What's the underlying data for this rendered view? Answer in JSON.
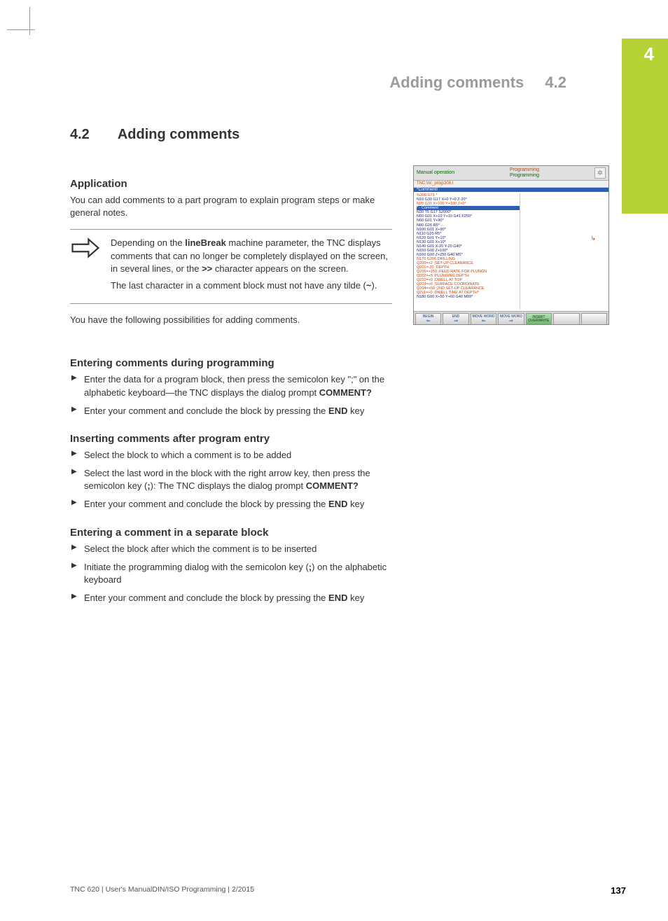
{
  "chapter_tab_number": "4",
  "header": {
    "title": "Adding comments",
    "number": "4.2"
  },
  "section": {
    "number": "4.2",
    "title": "Adding comments"
  },
  "application": {
    "heading": "Application",
    "intro": "You can add comments to a part program to explain program steps or make general notes.",
    "note_p1_a": "Depending on the ",
    "note_p1_bold": "lineBreak",
    "note_p1_b": " machine parameter, the TNC displays comments that can no longer be completely displayed on the screen, in several lines, or the ",
    "note_p1_bold2": ">>",
    "note_p1_c": " character appears on the screen.",
    "note_p2_a": "The last character in a comment block must not have any tilde (",
    "note_p2_bold": "~",
    "note_p2_b": ").",
    "after_note": "You have the following possibilities for adding comments."
  },
  "s1": {
    "heading": "Entering comments during programming",
    "li1_a": "Enter the data for a program block, then press the semicolon key \";\" on the alphabetic keyboard—the TNC displays the dialog prompt ",
    "li1_bold": "COMMENT?",
    "li2_a": "Enter your comment and conclude the block by pressing the ",
    "li2_bold": "END",
    "li2_b": " key"
  },
  "s2": {
    "heading": "Inserting comments after program entry",
    "li1": "Select the block to which a comment is to be added",
    "li2_a": "Select the last word in the block with the right arrow key, then press the semicolon key (",
    "li2_bold": ";",
    "li2_b": "): The TNC displays the dialog prompt ",
    "li2_bold2": "COMMENT?",
    "li3_a": "Enter your comment and conclude the block by pressing the ",
    "li3_bold": "END",
    "li3_b": " key"
  },
  "s3": {
    "heading": "Entering a comment in a separate block",
    "li1": "Select the block after which the comment is to be inserted",
    "li2_a": "Initiate the programming dialog with the semicolon key (",
    "li2_bold": ";",
    "li2_b": ") on the alphabetic keyboard",
    "li3_a": "Enter your comment and conclude the block by pressing the ",
    "li3_bold": "END",
    "li3_b": " key"
  },
  "screenshot": {
    "mode_left": "Manual operation",
    "mode_right_a": "Programming",
    "mode_right_b": "Programming",
    "progname": "TNC:\\nc_prog\\308.I",
    "hl_row": "*Comment!",
    "code_lines": [
      {
        "t": "%308 G71 *",
        "c": "o"
      },
      {
        "t": "N10 G30 G17 X+0 Y+0 Z-20*",
        "c": ""
      },
      {
        "t": "N20 G31 X+100 Y+100 Z+0*",
        "c": "o"
      },
      {
        "t": "* - Comment",
        "c": "hl"
      },
      {
        "t": "N30 T5 G17 S2000*",
        "c": ""
      },
      {
        "t": "N50 G01 X+10 Y+10 G41 F250*",
        "c": ""
      },
      {
        "t": "N60 G01 Y+90*",
        "c": ""
      },
      {
        "t": "N80 G26 R5*",
        "c": ""
      },
      {
        "t": "N100 G01 X+90*",
        "c": ""
      },
      {
        "t": "N110 G25 R5*",
        "c": ""
      },
      {
        "t": "N120 G01 Y+10*",
        "c": ""
      },
      {
        "t": "N130 G01 X+10*",
        "c": ""
      },
      {
        "t": "N140 G01 X-20 Y-20 G40*",
        "c": ""
      },
      {
        "t": "N150 G00 Z+100*",
        "c": ""
      },
      {
        "t": "N160 G00 Z+250 G40 M5*",
        "c": ""
      },
      {
        "t": "N170 G200 DRILLING",
        "c": "o"
      },
      {
        "t": "  Q200=+2    ;SET-UP CLEARANCE",
        "c": "o"
      },
      {
        "t": "  Q201=-20   ;DEPTH",
        "c": "o"
      },
      {
        "t": "  Q206=+150  ;FEED RATE FOR PLUNGN",
        "c": "o"
      },
      {
        "t": "  Q202=+5    ;PLUNGING DEPTH",
        "c": "o"
      },
      {
        "t": "  Q210=+0    ;DWELL AT TOP",
        "c": "o"
      },
      {
        "t": "  Q203=+0    ;SURFACE COORDINATE",
        "c": "o"
      },
      {
        "t": "  Q204=+50   ;2ND SET-UP CLEARANCE",
        "c": "o"
      },
      {
        "t": "  Q211=+0    ;DWELL TIME AT DEPTH*",
        "c": "o"
      },
      {
        "t": "N180 G00 X+50 Y+60 G40 M99*",
        "c": ""
      }
    ],
    "axis_icon_label": "↳",
    "buttons": [
      {
        "label": "BEGIN",
        "glyph": "⇐"
      },
      {
        "label": "END",
        "glyph": "⇒"
      },
      {
        "label": "MOVE WORD",
        "glyph": "⇐"
      },
      {
        "label": "MOVE WORD",
        "glyph": "⇒"
      },
      {
        "label": "INSERT OVERWRITE",
        "glyph": "",
        "ins": true
      },
      {
        "label": "",
        "glyph": ""
      },
      {
        "label": "",
        "glyph": ""
      }
    ],
    "gear_glyph": "✲"
  },
  "footer": {
    "left": "TNC 620 | User's ManualDIN/ISO Programming | 2/2015",
    "page": "137"
  }
}
